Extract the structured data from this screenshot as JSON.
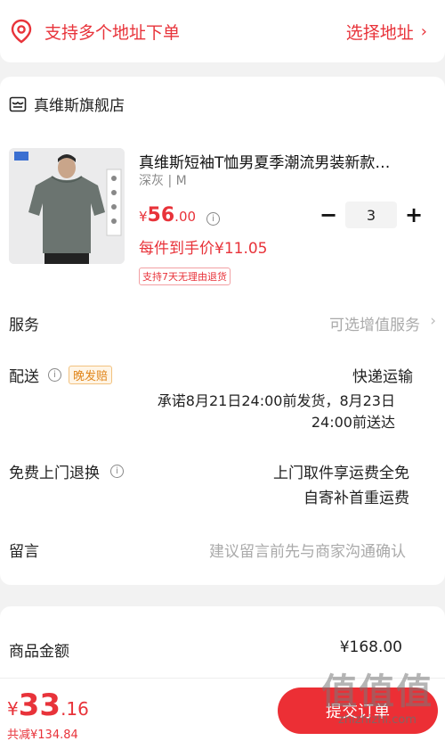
{
  "address_bar": {
    "text": "支持多个地址下单",
    "choose_label": "选择地址",
    "chevron": "›"
  },
  "shop": {
    "name": "真维斯旗舰店",
    "icon": "shop-icon"
  },
  "product": {
    "title": "真维斯短袖T恤男夏季潮流男装新款…",
    "spec": "深灰 | M",
    "price_currency": "¥",
    "price_int": "56",
    "price_dec": ".00",
    "each_price": "每件到手价¥11.05",
    "return_badge": "支持7天无理由退货",
    "quantity": "3",
    "minus": "−",
    "plus": "+"
  },
  "rows": {
    "service_label": "服务",
    "service_value": "可选增值服务",
    "service_chevron": "›",
    "delivery_label": "配送",
    "delivery_tag": "晚发赔",
    "delivery_method": "快递运输",
    "delivery_promise_1": "承诺8月21日24:00前发货，8月23日",
    "delivery_promise_2": "24:00前送达",
    "return_label": "免费上门退换",
    "return_line_1": "上门取件享运费全免",
    "return_line_2": "自寄补首重运费",
    "message_label": "留言",
    "message_placeholder": "建议留言前先与商家沟通确认"
  },
  "summary": {
    "amount_label": "商品金额",
    "amount_value": "¥168.00"
  },
  "footer": {
    "total_currency": "¥",
    "total_int": "33",
    "total_dec": ".16",
    "saved": "共减¥134.84",
    "submit_label": "提交订单"
  },
  "watermark": {
    "mark": "值值值",
    "url": "zhizhizhi.com"
  },
  "colors": {
    "accent": "#e8333a",
    "submit": "#ec2f35"
  }
}
